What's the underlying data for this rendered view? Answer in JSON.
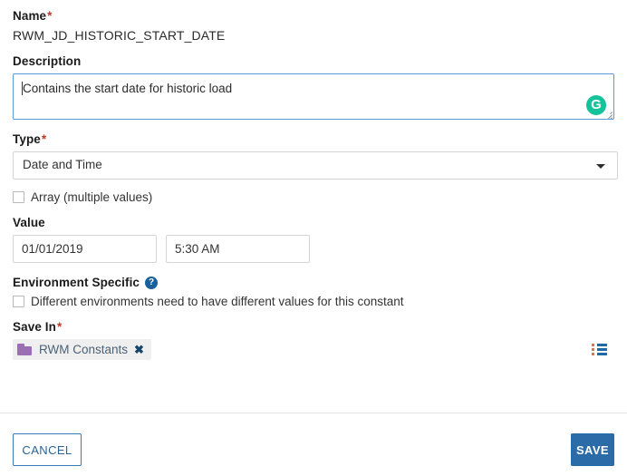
{
  "form": {
    "name": {
      "label": "Name",
      "required": "*",
      "value": "RWM_JD_HISTORIC_START_DATE"
    },
    "description": {
      "label": "Description",
      "value": "Contains the start date for historic load",
      "assistant_icon": "grammarly-icon",
      "assistant_letter": "G"
    },
    "type": {
      "label": "Type",
      "required": "*",
      "selected": "Date and Time"
    },
    "array_checkbox": {
      "label": "Array (multiple values)",
      "checked": false
    },
    "value": {
      "label": "Value",
      "date": "01/01/2019",
      "time": "5:30 AM"
    },
    "environment_specific": {
      "label": "Environment Specific",
      "help_glyph": "?",
      "checkbox_label": "Different environments need to have different values for this constant",
      "checked": false
    },
    "save_in": {
      "label": "Save In",
      "required": "*",
      "tag_text": "RWM Constants",
      "tag_remove_glyph": "✖",
      "folder_icon": "folder-icon",
      "list_icon": "list-view-icon"
    }
  },
  "footer": {
    "cancel_label": "CANCEL",
    "save_label": "SAVE"
  },
  "colors": {
    "accent_blue": "#2a6ba8",
    "cancel_border": "#3c7eb5",
    "required_red": "#c0392b",
    "help_blue": "#18619c",
    "folder_purple": "#9b6fb5",
    "grammarly_green": "#15c39a",
    "focus_border": "#5b9bd5",
    "list_icon_blue": "#1d6ba3",
    "list_icon_orange": "#e0734f"
  }
}
